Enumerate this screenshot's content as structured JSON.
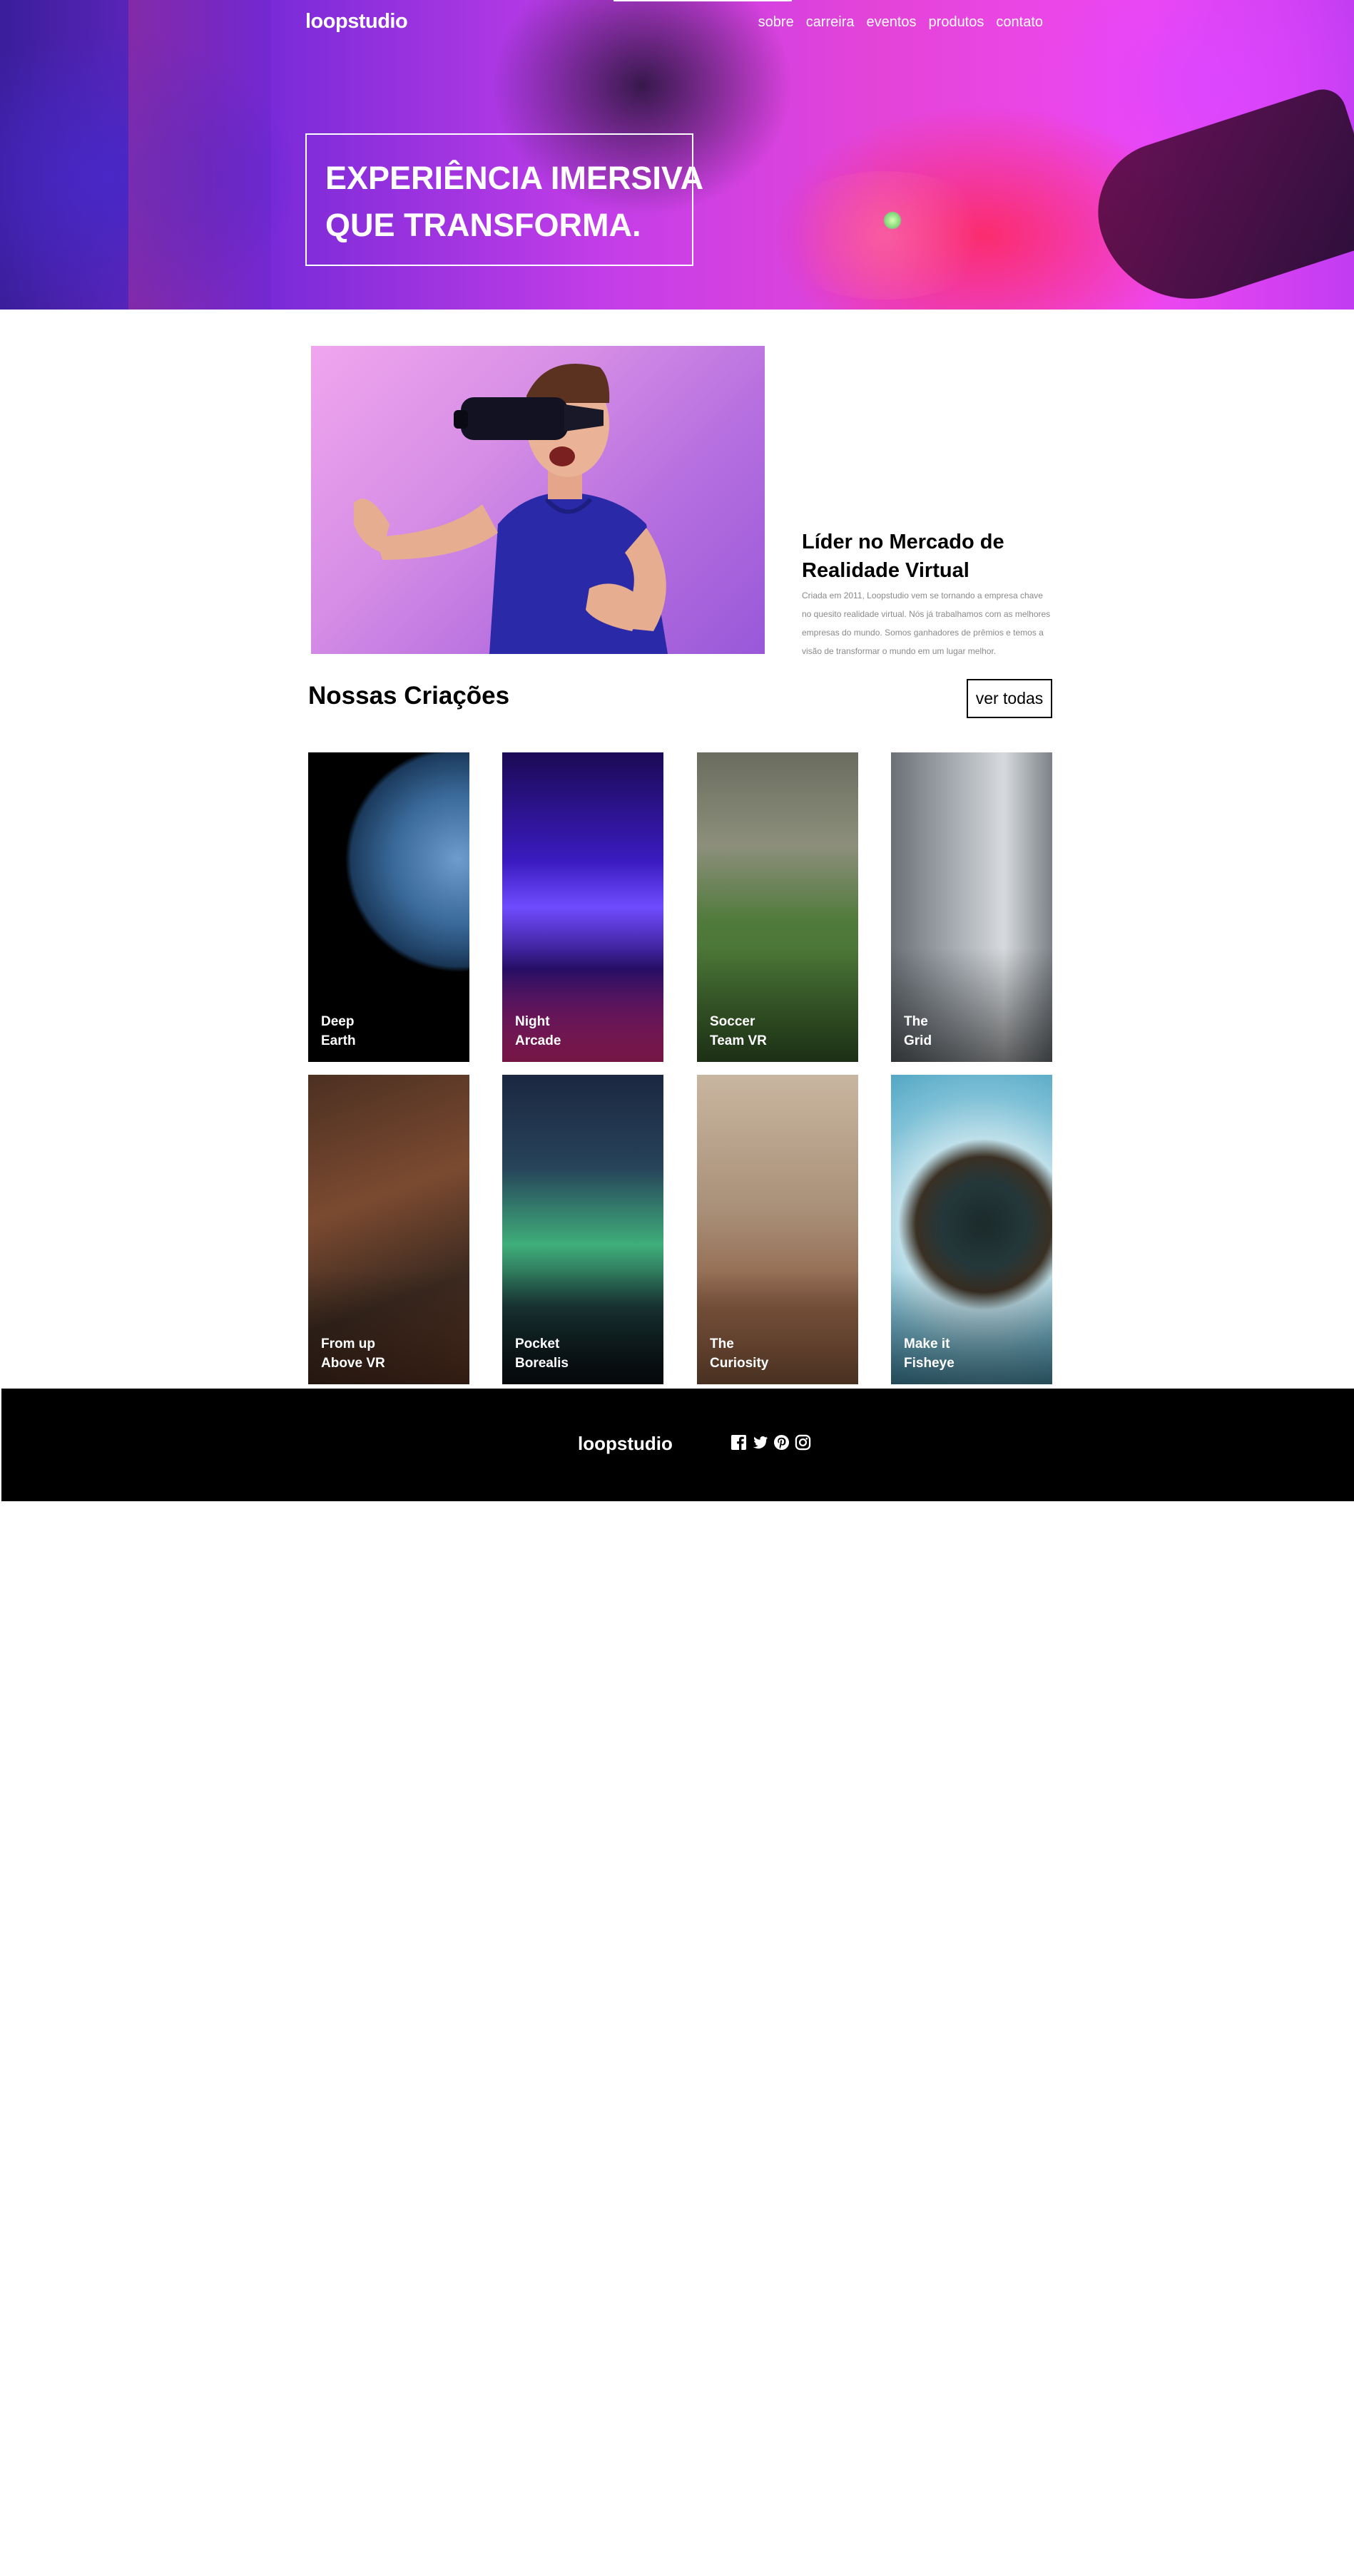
{
  "brand": {
    "logo": "loopstudio"
  },
  "nav": {
    "items": [
      "sobre",
      "carreira",
      "eventos",
      "produtos",
      "contato"
    ]
  },
  "hero": {
    "headline_line1": "EXPERIÊNCIA IMERSIVA",
    "headline_line2": "QUE TRANSFORMA."
  },
  "intro": {
    "title": "Líder no Mercado de Realidade Virtual",
    "text": "Criada em 2011, Loopstudio vem se tornando a empresa chave no quesito realidade virtual. Nós já trabalhamos com as melhores empresas do mundo. Somos ganhadores de prêmios e temos a visão de transformar o mundo em um lugar melhor."
  },
  "creations": {
    "title": "Nossas Criações",
    "see_all": "ver todas",
    "cards": [
      {
        "line1": "Deep",
        "line2": "Earth"
      },
      {
        "line1": "Night",
        "line2": "Arcade"
      },
      {
        "line1": "Soccer",
        "line2": "Team VR"
      },
      {
        "line1": "The",
        "line2": "Grid"
      },
      {
        "line1": "From up",
        "line2": "Above VR"
      },
      {
        "line1": "Pocket",
        "line2": "Borealis"
      },
      {
        "line1": "The",
        "line2": "Curiosity"
      },
      {
        "line1": "Make it",
        "line2": "Fisheye"
      }
    ]
  },
  "footer": {
    "logo": "loopstudio",
    "social_icons": [
      "facebook-icon",
      "twitter-icon",
      "pinterest-icon",
      "instagram-icon"
    ]
  }
}
